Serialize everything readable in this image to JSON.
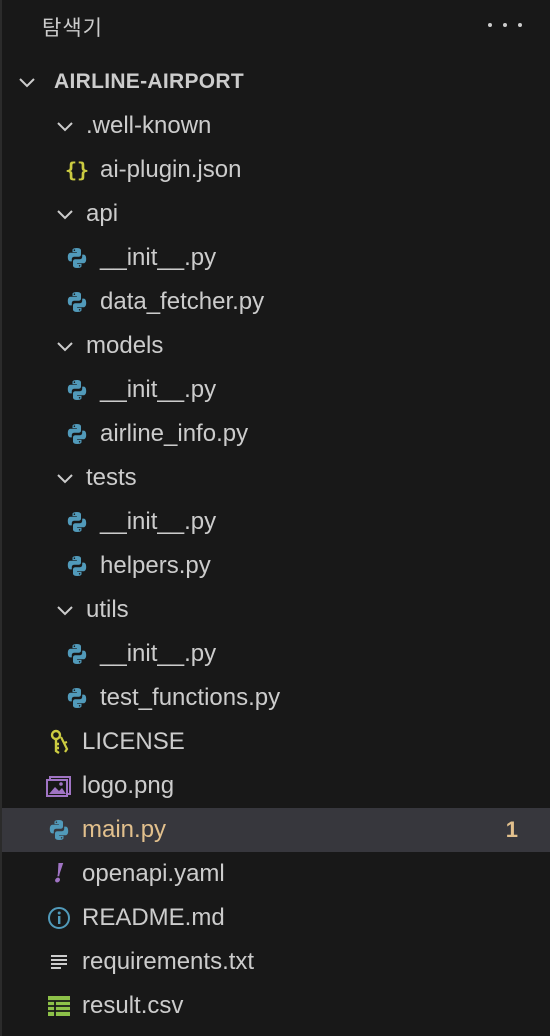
{
  "header": {
    "title": "탐색기"
  },
  "root": {
    "label": "AIRLINE-AIRPORT"
  },
  "tree": [
    {
      "name": "folder-well-known",
      "type": "folder",
      "label": ".well-known"
    },
    {
      "name": "file-ai-plugin-json",
      "type": "file",
      "icon": "json",
      "label": "ai-plugin.json"
    },
    {
      "name": "folder-api",
      "type": "folder",
      "label": "api"
    },
    {
      "name": "file-api-init-py",
      "type": "file",
      "icon": "python",
      "label": "__init__.py"
    },
    {
      "name": "file-data-fetcher-py",
      "type": "file",
      "icon": "python",
      "label": "data_fetcher.py"
    },
    {
      "name": "folder-models",
      "type": "folder",
      "label": "models"
    },
    {
      "name": "file-models-init-py",
      "type": "file",
      "icon": "python",
      "label": "__init__.py"
    },
    {
      "name": "file-airline-info-py",
      "type": "file",
      "icon": "python",
      "label": "airline_info.py"
    },
    {
      "name": "folder-tests",
      "type": "folder",
      "label": "tests"
    },
    {
      "name": "file-tests-init-py",
      "type": "file",
      "icon": "python",
      "label": "__init__.py"
    },
    {
      "name": "file-helpers-py",
      "type": "file",
      "icon": "python",
      "label": "helpers.py"
    },
    {
      "name": "folder-utils",
      "type": "folder",
      "label": "utils"
    },
    {
      "name": "file-utils-init-py",
      "type": "file",
      "icon": "python",
      "label": "__init__.py"
    },
    {
      "name": "file-test-functions-py",
      "type": "file",
      "icon": "python",
      "label": "test_functions.py"
    },
    {
      "name": "file-license",
      "type": "rootfile",
      "icon": "license",
      "label": "LICENSE"
    },
    {
      "name": "file-logo-png",
      "type": "rootfile",
      "icon": "image",
      "label": "logo.png"
    },
    {
      "name": "file-main-py",
      "type": "rootfile",
      "icon": "python",
      "label": "main.py",
      "selected": true,
      "badge": "1"
    },
    {
      "name": "file-openapi-yaml",
      "type": "rootfile",
      "icon": "yaml",
      "label": "openapi.yaml"
    },
    {
      "name": "file-readme-md",
      "type": "rootfile",
      "icon": "info",
      "label": "README.md"
    },
    {
      "name": "file-requirements-txt",
      "type": "rootfile",
      "icon": "text",
      "label": "requirements.txt"
    },
    {
      "name": "file-result-csv",
      "type": "rootfile",
      "icon": "table",
      "label": "result.csv"
    }
  ],
  "colors": {
    "background": "#181818",
    "selected_row": "#37373d",
    "modified_text": "#e2c08d",
    "python_blue": "#519aba",
    "json_yellow": "#cbcb41",
    "yaml_purple": "#a074c4",
    "license_yellow": "#cbcb41",
    "csv_green": "#8dc149",
    "image_purple": "#a074c4"
  }
}
